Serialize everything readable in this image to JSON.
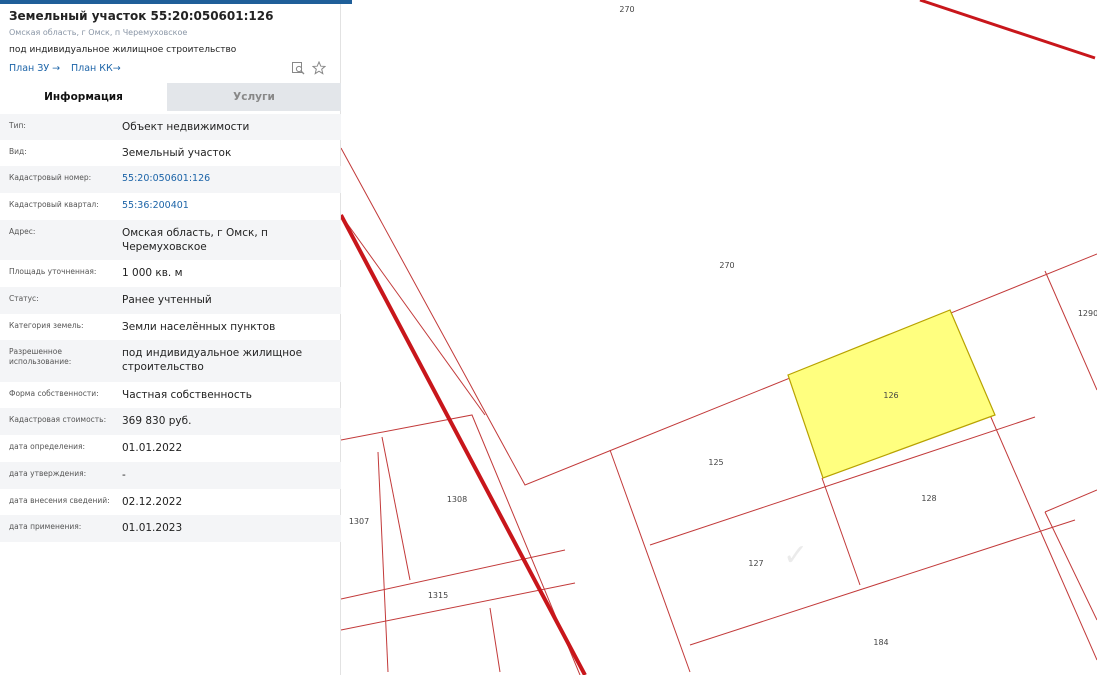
{
  "panel": {
    "title": "Земельный участок 55:20:050601:126",
    "address": "Омская область, г Омск, п Черемуховское",
    "usage": "под индивидуальное жилищное строительство",
    "links": [
      "План ЗУ →",
      "План КК→"
    ],
    "icons": [
      "search-document-icon",
      "star-icon"
    ],
    "tabs": {
      "info": "Информация",
      "services": "Услуги"
    },
    "rows": [
      {
        "label": "Тип:",
        "value": "Объект недвижимости"
      },
      {
        "label": "Вид:",
        "value": "Земельный участок"
      },
      {
        "label": "Кадастровый номер:",
        "value": "55:20:050601:126",
        "link": true
      },
      {
        "label": "Кадастровый квартал:",
        "value": "55:36:200401",
        "link": true
      },
      {
        "label": "Адрес:",
        "value": "Омская область, г Омск, п Черемуховское"
      },
      {
        "label": "Площадь уточненная:",
        "value": "1 000 кв. м"
      },
      {
        "label": "Статус:",
        "value": "Ранее учтенный"
      },
      {
        "label": "Категория земель:",
        "value": "Земли населённых пунктов"
      },
      {
        "label": "Разрешенное использование:",
        "value": "под индивидуальное жилищное строительство"
      },
      {
        "label": "Форма собственности:",
        "value": "Частная собственность"
      },
      {
        "label": "Кадастровая стоимость:",
        "value": "369 830 руб."
      },
      {
        "label": "дата определения:",
        "value": "01.01.2022"
      },
      {
        "label": "дата утверждения:",
        "value": "-"
      },
      {
        "label": "дата внесения сведений:",
        "value": "02.12.2022"
      },
      {
        "label": "дата применения:",
        "value": "01.01.2023"
      }
    ]
  },
  "map": {
    "parcel_labels": [
      "270",
      "270",
      "1290",
      "126",
      "125",
      "128",
      "127",
      "184",
      "1308",
      "1307",
      "1315"
    ],
    "selected_parcel": "126",
    "colors": {
      "boundary": "#c0392b",
      "road": "#c8161b",
      "selected_fill": "#ffff7f",
      "selected_stroke": "#b8a200",
      "accent": "#1c64a8"
    }
  }
}
